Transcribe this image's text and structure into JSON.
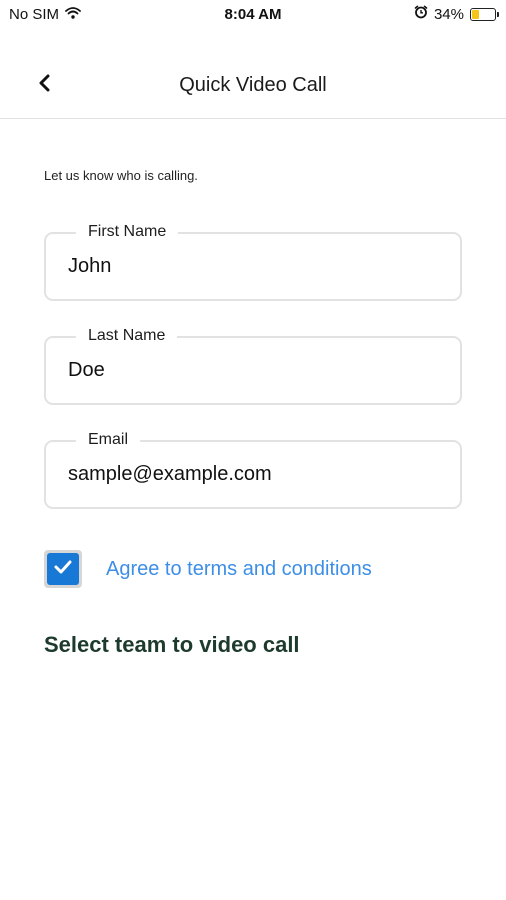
{
  "status_bar": {
    "carrier": "No SIM",
    "time": "8:04 AM",
    "battery_percent": "34%",
    "battery_level": 0.34,
    "icons": [
      "wifi-icon",
      "alarm-icon",
      "battery-icon"
    ]
  },
  "nav": {
    "title": "Quick Video Call",
    "back_icon": "chevron-left-icon"
  },
  "form": {
    "intro": "Let us know who is calling.",
    "first_name": {
      "label": "First Name",
      "value": "John"
    },
    "last_name": {
      "label": "Last Name",
      "value": "Doe"
    },
    "email": {
      "label": "Email",
      "value": "sample@example.com"
    },
    "terms": {
      "label": "Agree to terms and conditions",
      "checked": true
    }
  },
  "team_section": {
    "title": "Select team to video call"
  },
  "colors": {
    "accent": "#1778d6",
    "link": "#3d8ee6",
    "section_title": "#1d3b2c",
    "field_border": "#e2e2e2",
    "battery": "#f5c518"
  }
}
